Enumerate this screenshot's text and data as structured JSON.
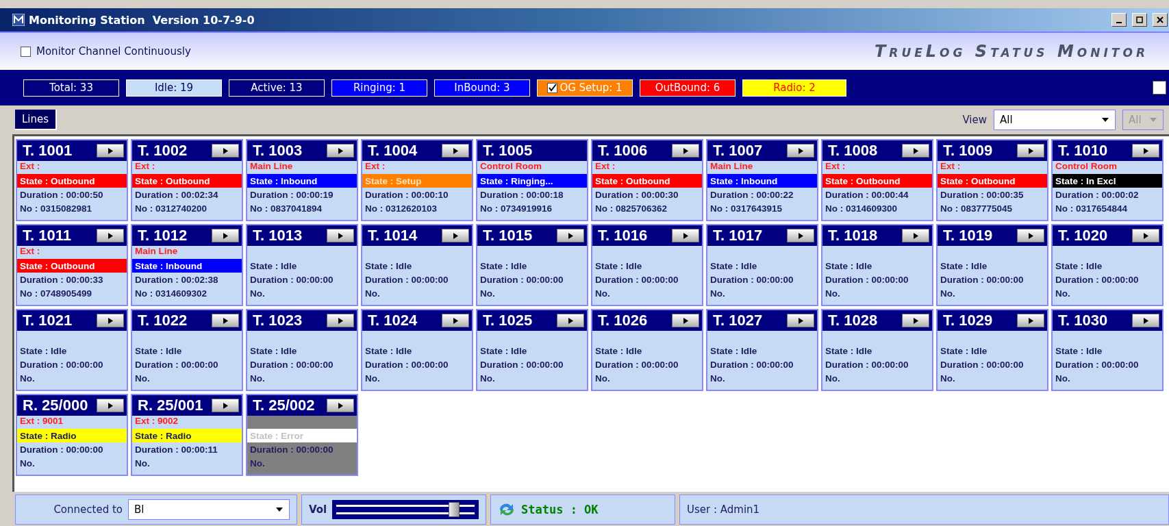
{
  "window": {
    "title": "Monitoring Station  Version 10-7-9-0"
  },
  "header": {
    "monitor_checkbox": {
      "label": "Monitor Channel Continuously",
      "checked": false
    },
    "brand": "TrueLog Status Monitor"
  },
  "counters": [
    {
      "label": "Total: 33",
      "kind": "total"
    },
    {
      "label": "Idle: 19",
      "kind": "idle"
    },
    {
      "label": "Active: 13",
      "kind": "active"
    },
    {
      "label": "Ringing: 1",
      "kind": "ringing"
    },
    {
      "label": "InBound: 3",
      "kind": "inbound"
    },
    {
      "label": "OG Setup: 1",
      "kind": "setup",
      "checkbox": {
        "checked": true
      }
    },
    {
      "label": "OutBound: 6",
      "kind": "outbound"
    },
    {
      "label": "Radio: 2",
      "kind": "radio"
    }
  ],
  "counter_bar_checkbox": {
    "checked": false
  },
  "toolbar": {
    "tab": {
      "label": "Lines",
      "selected": true
    },
    "view_label": "View",
    "view_select": "All",
    "second_select": {
      "value": "All",
      "disabled": true
    }
  },
  "lines": [
    {
      "title": "T. 1001",
      "button": true,
      "line": "Ext :",
      "state": "State : Outbound",
      "kind": "outbound",
      "duration": "Duration : 00:00:50",
      "number": "No : 0315082981"
    },
    {
      "title": "T. 1002",
      "button": true,
      "line": "Ext :",
      "state": "State : Outbound",
      "kind": "outbound",
      "duration": "Duration : 00:02:34",
      "number": "No : 0312740200"
    },
    {
      "title": "T. 1003",
      "button": true,
      "line": "Main Line",
      "state": "State : Inbound",
      "kind": "inbound",
      "duration": "Duration : 00:00:19",
      "number": "No : 0837041894"
    },
    {
      "title": "T. 1004",
      "button": true,
      "line": "Ext :",
      "state": "State : Setup",
      "kind": "setup",
      "duration": "Duration : 00:00:10",
      "number": "No : 0312620103"
    },
    {
      "title": "T. 1005",
      "button": false,
      "line": "Control Room",
      "state": "State : Ringing...",
      "kind": "ringing",
      "duration": "Duration : 00:00:18",
      "number": "No : 0734919916"
    },
    {
      "title": "T. 1006",
      "button": true,
      "line": "Ext :",
      "state": "State : Outbound",
      "kind": "outbound",
      "duration": "Duration : 00:00:30",
      "number": "No : 0825706362"
    },
    {
      "title": "T. 1007",
      "button": true,
      "line": "Main Line",
      "state": "State : Inbound",
      "kind": "inbound",
      "duration": "Duration : 00:00:22",
      "number": "No : 0317643915"
    },
    {
      "title": "T. 1008",
      "button": true,
      "line": "Ext :",
      "state": "State : Outbound",
      "kind": "outbound",
      "duration": "Duration : 00:00:44",
      "number": "No : 0314609300"
    },
    {
      "title": "T. 1009",
      "button": true,
      "line": "Ext :",
      "state": "State : Outbound",
      "kind": "outbound",
      "duration": "Duration : 00:00:35",
      "number": "No : 0837775045"
    },
    {
      "title": "T. 1010",
      "button": true,
      "line": "Control Room",
      "state": "State : In Excl",
      "kind": "excl",
      "duration": "Duration : 00:00:02",
      "number": "No : 0317654844"
    },
    {
      "title": "T. 1011",
      "button": true,
      "line": "Ext :",
      "state": "State : Outbound",
      "kind": "outbound",
      "duration": "Duration : 00:00:33",
      "number": "No : 0748905499"
    },
    {
      "title": "T. 1012",
      "button": true,
      "line": "Main Line",
      "state": "State : Inbound",
      "kind": "inbound",
      "duration": "Duration : 00:02:38",
      "number": "No : 0314609302"
    },
    {
      "title": "T. 1013",
      "button": true,
      "state": "State : Idle",
      "kind": "idle",
      "duration": "Duration : 00:00:00",
      "number": "No."
    },
    {
      "title": "T. 1014",
      "button": true,
      "state": "State : Idle",
      "kind": "idle",
      "duration": "Duration : 00:00:00",
      "number": "No."
    },
    {
      "title": "T. 1015",
      "button": true,
      "state": "State : Idle",
      "kind": "idle",
      "duration": "Duration : 00:00:00",
      "number": "No."
    },
    {
      "title": "T. 1016",
      "button": true,
      "state": "State : Idle",
      "kind": "idle",
      "duration": "Duration : 00:00:00",
      "number": "No."
    },
    {
      "title": "T. 1017",
      "button": true,
      "state": "State : Idle",
      "kind": "idle",
      "duration": "Duration : 00:00:00",
      "number": "No."
    },
    {
      "title": "T. 1018",
      "button": true,
      "state": "State : Idle",
      "kind": "idle",
      "duration": "Duration : 00:00:00",
      "number": "No."
    },
    {
      "title": "T. 1019",
      "button": true,
      "state": "State : Idle",
      "kind": "idle",
      "duration": "Duration : 00:00:00",
      "number": "No."
    },
    {
      "title": "T. 1020",
      "button": true,
      "state": "State : Idle",
      "kind": "idle",
      "duration": "Duration : 00:00:00",
      "number": "No."
    },
    {
      "title": "T. 1021",
      "button": true,
      "state": "State : Idle",
      "kind": "idle",
      "duration": "Duration : 00:00:00",
      "number": "No."
    },
    {
      "title": "T. 1022",
      "button": true,
      "state": "State : Idle",
      "kind": "idle",
      "duration": "Duration : 00:00:00",
      "number": "No."
    },
    {
      "title": "T. 1023",
      "button": true,
      "state": "State : Idle",
      "kind": "idle",
      "duration": "Duration : 00:00:00",
      "number": "No."
    },
    {
      "title": "T. 1024",
      "button": true,
      "state": "State : Idle",
      "kind": "idle",
      "duration": "Duration : 00:00:00",
      "number": "No."
    },
    {
      "title": "T. 1025",
      "button": true,
      "state": "State : Idle",
      "kind": "idle",
      "duration": "Duration : 00:00:00",
      "number": "No."
    },
    {
      "title": "T. 1026",
      "button": true,
      "state": "State : Idle",
      "kind": "idle",
      "duration": "Duration : 00:00:00",
      "number": "No."
    },
    {
      "title": "T. 1027",
      "button": true,
      "state": "State : Idle",
      "kind": "idle",
      "duration": "Duration : 00:00:00",
      "number": "No."
    },
    {
      "title": "T. 1028",
      "button": true,
      "state": "State : Idle",
      "kind": "idle",
      "duration": "Duration : 00:00:00",
      "number": "No."
    },
    {
      "title": "T. 1029",
      "button": true,
      "state": "State : Idle",
      "kind": "idle",
      "duration": "Duration : 00:00:00",
      "number": "No."
    },
    {
      "title": "T. 1030",
      "button": true,
      "state": "State : Idle",
      "kind": "idle",
      "duration": "Duration : 00:00:00",
      "number": "No."
    },
    {
      "title": "R. 25/000",
      "button": true,
      "line": "Ext : 9001",
      "state": "State : Radio",
      "kind": "radio",
      "duration": "Duration : 00:00:00",
      "number": "No."
    },
    {
      "title": "R. 25/001",
      "button": true,
      "line": "Ext : 9002",
      "state": "State : Radio",
      "kind": "radio",
      "duration": "Duration : 00:00:11",
      "number": "No."
    },
    {
      "title": "T. 25/002",
      "button": true,
      "state": "State : Error",
      "kind": "error",
      "duration": "Duration : 00:00:00",
      "number": "No."
    }
  ],
  "status_bar": {
    "connected_label": "Connected to",
    "connected_value": "Bl",
    "volume_label": "Vol",
    "volume": {
      "level": 0.83
    },
    "status": "Status : OK",
    "user": "User : Admin1"
  }
}
